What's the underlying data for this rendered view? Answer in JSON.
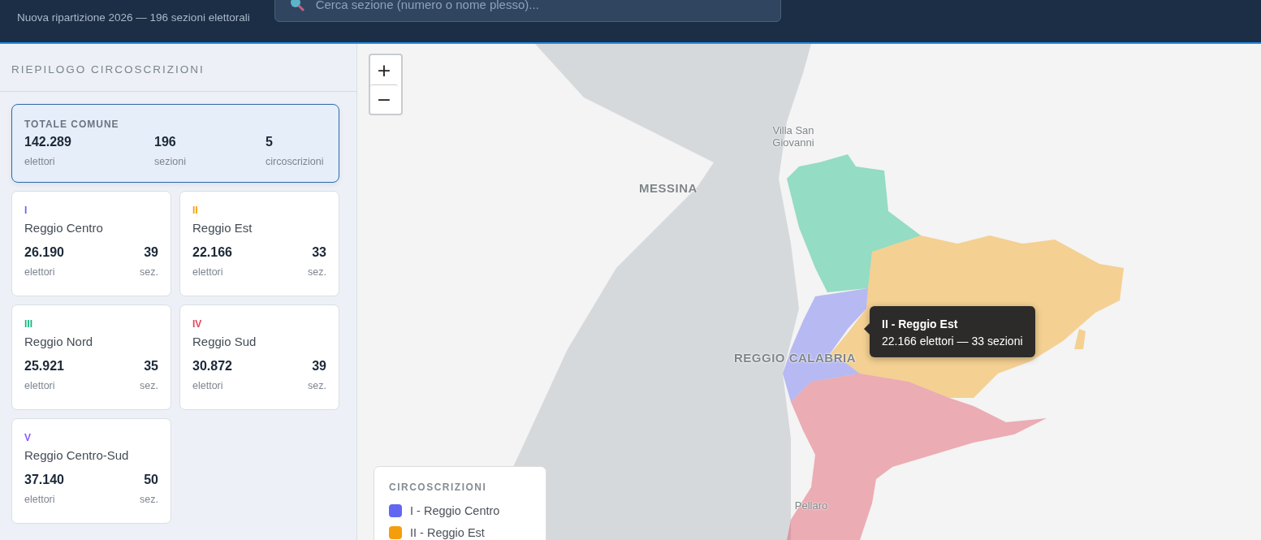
{
  "header": {
    "subtitle": "Nuova ripartizione 2026 — 196 sezioni elettorali",
    "search": {
      "placeholder": "Cerca sezione (numero o nome plesso)..."
    }
  },
  "sidebar": {
    "title": "RIEPILOGO CIRCOSCRIZIONI",
    "total": {
      "label": "TOTALE COMUNE",
      "stats": [
        {
          "value": "142.289",
          "label": "elettori"
        },
        {
          "value": "196",
          "label": "sezioni"
        },
        {
          "value": "5",
          "label": "circoscrizioni"
        }
      ]
    },
    "districts": [
      {
        "numeral": "I",
        "name": "Reggio Centro",
        "color": "#6366f1",
        "electors": "26.190",
        "electors_label": "elettori",
        "sections": "39",
        "sections_label": "sez."
      },
      {
        "numeral": "II",
        "name": "Reggio Est",
        "color": "#f59e0b",
        "electors": "22.166",
        "electors_label": "elettori",
        "sections": "33",
        "sections_label": "sez."
      },
      {
        "numeral": "III",
        "name": "Reggio Nord",
        "color": "#10b981",
        "electors": "25.921",
        "electors_label": "elettori",
        "sections": "35",
        "sections_label": "sez."
      },
      {
        "numeral": "IV",
        "name": "Reggio Sud",
        "color": "#e0475b",
        "electors": "30.872",
        "electors_label": "elettori",
        "sections": "39",
        "sections_label": "sez."
      },
      {
        "numeral": "V",
        "name": "Reggio Centro-Sud",
        "color": "#8b5cf6",
        "electors": "37.140",
        "electors_label": "elettori",
        "sections": "50",
        "sections_label": "sez."
      }
    ]
  },
  "map": {
    "zoom_in": "+",
    "zoom_out": "−",
    "place_labels": [
      {
        "text": "MESSINA",
        "kind": "city"
      },
      {
        "text": "Villa San Giovanni",
        "kind": "town"
      },
      {
        "text": "REGGIO CALABRIA",
        "kind": "city"
      },
      {
        "text": "Pellaro",
        "kind": "town"
      }
    ],
    "tooltip": {
      "title": "II - Reggio Est",
      "text": "22.166 elettori — 33 sezioni"
    },
    "legend": {
      "title": "CIRCOSCRIZIONI",
      "items": [
        {
          "label": "I - Reggio Centro",
          "color": "#6366f1"
        },
        {
          "label": "II - Reggio Est",
          "color": "#f59e0b"
        }
      ]
    }
  }
}
